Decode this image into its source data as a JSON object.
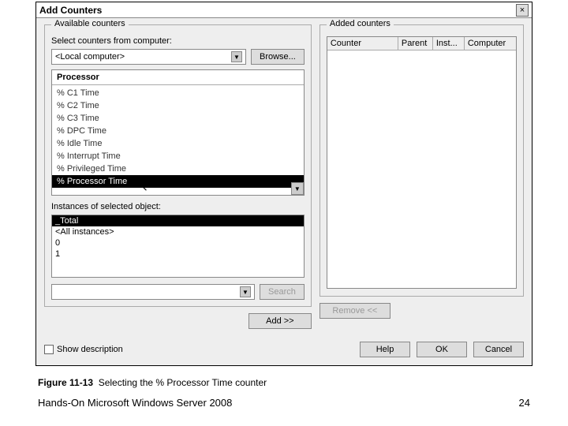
{
  "dialog": {
    "title": "Add Counters",
    "close": "×"
  },
  "available": {
    "legend": "Available counters",
    "select_label": "Select counters from computer:",
    "computer": "<Local computer>",
    "browse": "Browse...",
    "group": "Processor",
    "items": [
      "% C1 Time",
      "% C2 Time",
      "% C3 Time",
      "% DPC Time",
      "% Idle Time",
      "% Interrupt Time",
      "% Privileged Time",
      "% Processor Time"
    ],
    "instances_label": "Instances of selected object:",
    "instances": [
      "_Total",
      "<All instances>",
      "0",
      "1"
    ],
    "search_btn": "Search",
    "add_btn": "Add >>"
  },
  "added": {
    "legend": "Added counters",
    "columns": [
      "Counter",
      "Parent",
      "Inst...",
      "Computer"
    ],
    "remove_btn": "Remove <<"
  },
  "footer": {
    "show_desc": "Show description",
    "help": "Help",
    "ok": "OK",
    "cancel": "Cancel"
  },
  "caption": {
    "fig": "Figure 11-13",
    "text": "Selecting the % Processor Time counter"
  },
  "page": {
    "book": "Hands-On Microsoft Windows Server 2008",
    "num": "24"
  }
}
